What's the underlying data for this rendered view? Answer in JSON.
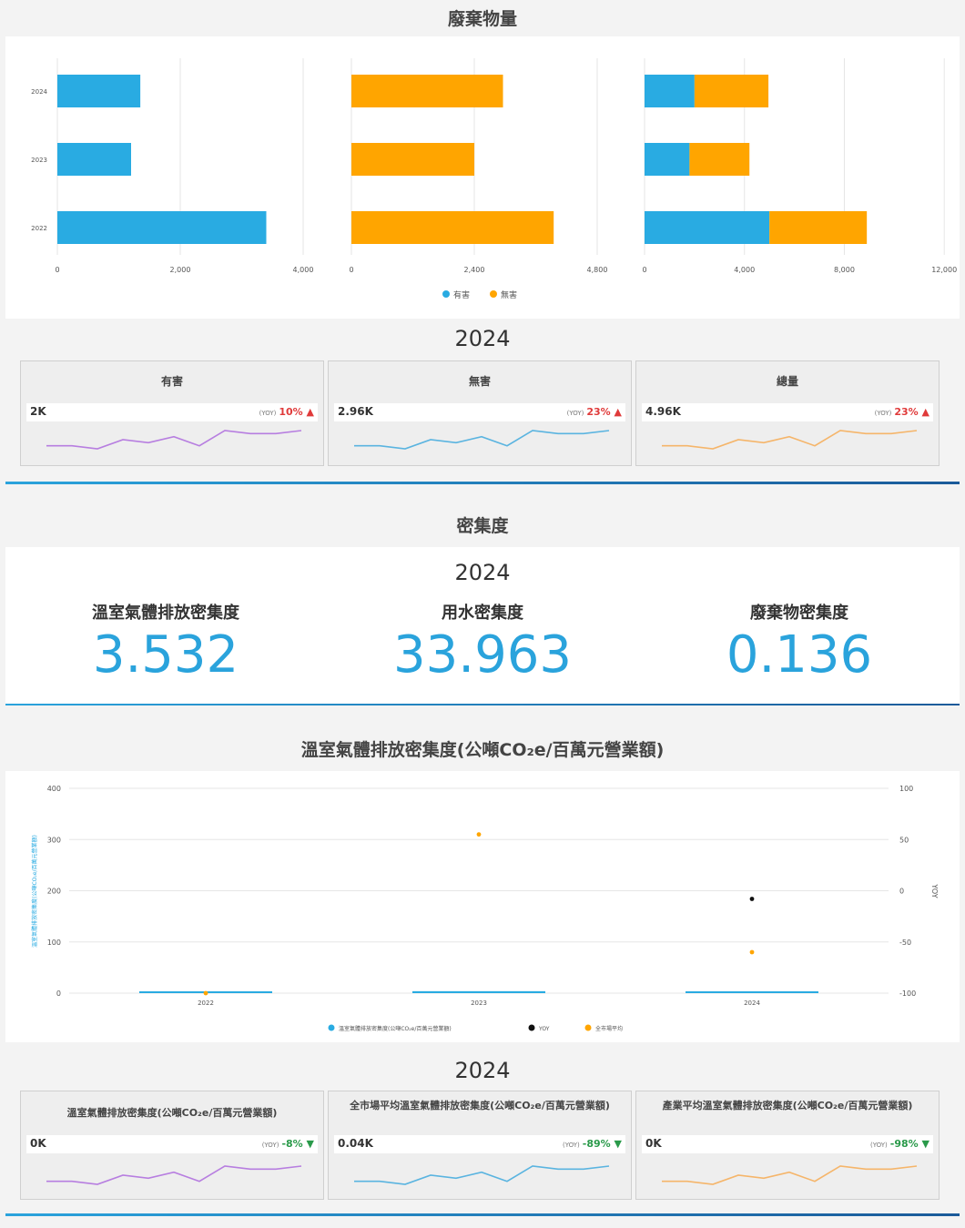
{
  "waste": {
    "title": "廢棄物量",
    "legend": [
      {
        "label": "有害",
        "color": "#29abe2"
      },
      {
        "label": "無害",
        "color": "#ffa500"
      }
    ],
    "year": "2024",
    "kpis": [
      {
        "title": "有害",
        "value": "2K",
        "yoy_label": "(YOY)",
        "yoy": "10%",
        "trend": "up",
        "color": "#b77ee0",
        "spark": [
          3,
          3,
          2,
          5,
          4,
          6,
          3,
          8,
          7,
          7,
          8
        ]
      },
      {
        "title": "無害",
        "value": "2.96K",
        "yoy_label": "(YOY)",
        "yoy": "23%",
        "trend": "up",
        "color": "#5ab4e0",
        "spark": [
          3,
          3,
          2,
          5,
          4,
          6,
          3,
          8,
          7,
          7,
          8
        ]
      },
      {
        "title": "總量",
        "value": "4.96K",
        "yoy_label": "(YOY)",
        "yoy": "23%",
        "trend": "up",
        "color": "#f5b56a",
        "spark": [
          3,
          3,
          2,
          5,
          4,
          6,
          3,
          8,
          7,
          7,
          8
        ]
      }
    ]
  },
  "intensity": {
    "title": "密集度",
    "year": "2024",
    "items": [
      {
        "label": "溫室氣體排放密集度",
        "value": "3.532"
      },
      {
        "label": "用水密集度",
        "value": "33.963"
      },
      {
        "label": "廢棄物密集度",
        "value": "0.136"
      }
    ]
  },
  "ghg": {
    "title": "溫室氣體排放密集度(公噸CO₂e/百萬元營業額)",
    "year": "2024",
    "kpis": [
      {
        "title": "溫室氣體排放密集度(公噸CO₂e/百萬元營業額)",
        "value": "0K",
        "yoy_label": "(YOY)",
        "yoy": "-8%",
        "trend": "down",
        "color": "#b77ee0",
        "spark": [
          3,
          3,
          2,
          5,
          4,
          6,
          3,
          8,
          7,
          7,
          8
        ]
      },
      {
        "title": "全市場平均溫室氣體排放密集度(公噸CO₂e/百萬元營業額)",
        "value": "0.04K",
        "yoy_label": "(YOY)",
        "yoy": "-89%",
        "trend": "down",
        "color": "#5ab4e0",
        "spark": [
          3,
          3,
          2,
          5,
          4,
          6,
          3,
          8,
          7,
          7,
          8
        ]
      },
      {
        "title": "產業平均溫室氣體排放密集度(公噸CO₂e/百萬元營業額)",
        "value": "0K",
        "yoy_label": "(YOY)",
        "yoy": "-98%",
        "trend": "down",
        "color": "#f5b56a",
        "spark": [
          3,
          3,
          2,
          5,
          4,
          6,
          3,
          8,
          7,
          7,
          8
        ]
      }
    ]
  },
  "chart_data": [
    {
      "type": "bar",
      "orientation": "horizontal",
      "panel": "有害",
      "categories": [
        "2024",
        "2023",
        "2022"
      ],
      "series": [
        {
          "name": "有害",
          "color": "#29abe2",
          "values": [
            1350,
            1200,
            3400
          ]
        }
      ],
      "xlim": [
        0,
        4000
      ],
      "xticks": [
        "0",
        "2,000",
        "4,000"
      ]
    },
    {
      "type": "bar",
      "orientation": "horizontal",
      "panel": "無害",
      "categories": [
        "2024",
        "2023",
        "2022"
      ],
      "series": [
        {
          "name": "無害",
          "color": "#ffa500",
          "values": [
            2960,
            2400,
            3950
          ]
        }
      ],
      "xlim": [
        0,
        4800
      ],
      "xticks": [
        "0",
        "2,400",
        "4,800"
      ]
    },
    {
      "type": "bar",
      "orientation": "horizontal",
      "stacked": true,
      "panel": "總量",
      "categories": [
        "2024",
        "2023",
        "2022"
      ],
      "series": [
        {
          "name": "有害",
          "color": "#29abe2",
          "values": [
            2000,
            1800,
            5000
          ]
        },
        {
          "name": "無害",
          "color": "#ffa500",
          "values": [
            2960,
            2400,
            3900
          ]
        }
      ],
      "xlim": [
        0,
        11300
      ],
      "xticks": [
        "0",
        "4,000",
        "8,000",
        "12,000"
      ]
    },
    {
      "type": "bar",
      "categories": [
        "2022",
        "2023",
        "2024"
      ],
      "series": [
        {
          "name": "溫室氣體排放密集度(公噸CO₂e/百萬元營業額)",
          "color": "#29abe2",
          "axis": "left",
          "values": [
            0,
            3.8,
            3.532
          ]
        },
        {
          "name": "YOY",
          "color": "#111111",
          "axis": "right",
          "type": "scatter",
          "values": [
            null,
            null,
            -8
          ]
        },
        {
          "name": "全市場平均",
          "color": "#ffa500",
          "axis": "right",
          "type": "scatter",
          "values": [
            -100,
            55,
            -60
          ]
        }
      ],
      "ylim": [
        0,
        400
      ],
      "yticks": [
        "0",
        "100",
        "200",
        "300",
        "400"
      ],
      "y2lim": [
        -100,
        100
      ],
      "y2ticks": [
        "-100",
        "-50",
        "0",
        "50",
        "100"
      ],
      "ylabel": "溫室氣體排放密集度(公噸CO₂e/百萬元營業額)",
      "y2label": "YOY",
      "legend": "bottom"
    }
  ]
}
